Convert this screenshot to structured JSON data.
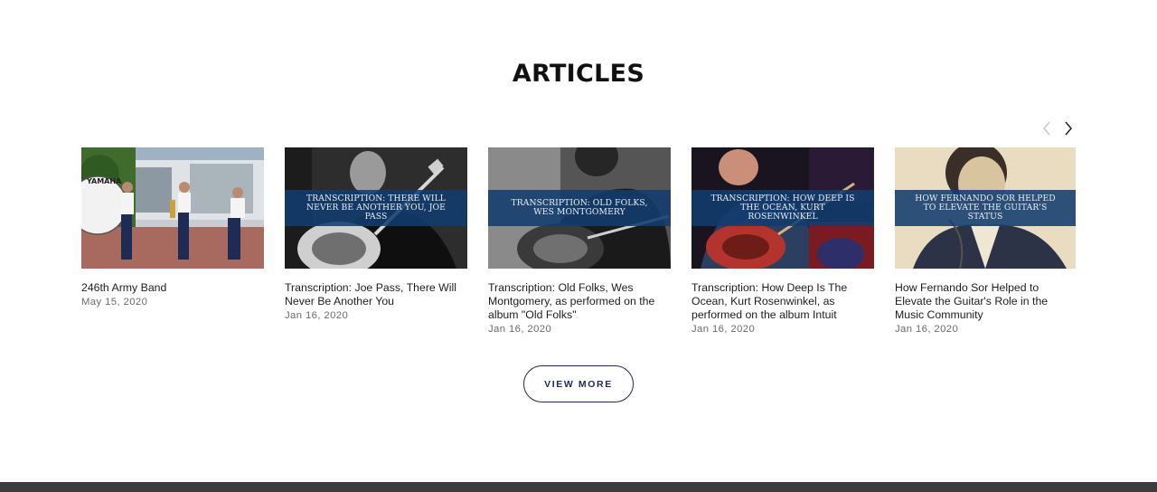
{
  "section": {
    "title": "ARTICLES"
  },
  "carousel": {
    "prev_icon": "chevron-left-icon",
    "next_icon": "chevron-right-icon"
  },
  "articles": [
    {
      "title": "246th Army Band",
      "date": "May 15, 2020",
      "banner": "",
      "image": "marching-band-photo"
    },
    {
      "title": "Transcription: Joe Pass, There Will Never Be Another You",
      "date": "Jan 16, 2020",
      "banner": "Transcription: There Will Never Be Another You, Joe Pass",
      "image": "guitarist-bw-photo"
    },
    {
      "title": "Transcription: Old Folks, Wes Montgomery, as performed on the album \"Old Folks\"",
      "date": "Jan 16, 2020",
      "banner": "Transcription: Old Folks, Wes Montgomery",
      "image": "guitarist-bw-photo"
    },
    {
      "title": "Transcription: How Deep Is The Ocean, Kurt Rosenwinkel, as performed on the album Intuit",
      "date": "Jan 16, 2020",
      "banner": "Transcription: How Deep Is The Ocean, Kurt Rosenwinkel",
      "image": "guitarist-color-photo"
    },
    {
      "title": "How Fernando Sor Helped to Elevate the Guitar's Role in the Music Community",
      "date": "Jan 16, 2020",
      "banner": "How Fernando Sor Helped to Elevate the Guitar's Status",
      "image": "portrait-engraving"
    }
  ],
  "view_more": {
    "label": "VIEW MORE"
  },
  "colors": {
    "accent": "#1f2a55",
    "banner": "#123c6e",
    "footer": "#3d3d3f"
  }
}
